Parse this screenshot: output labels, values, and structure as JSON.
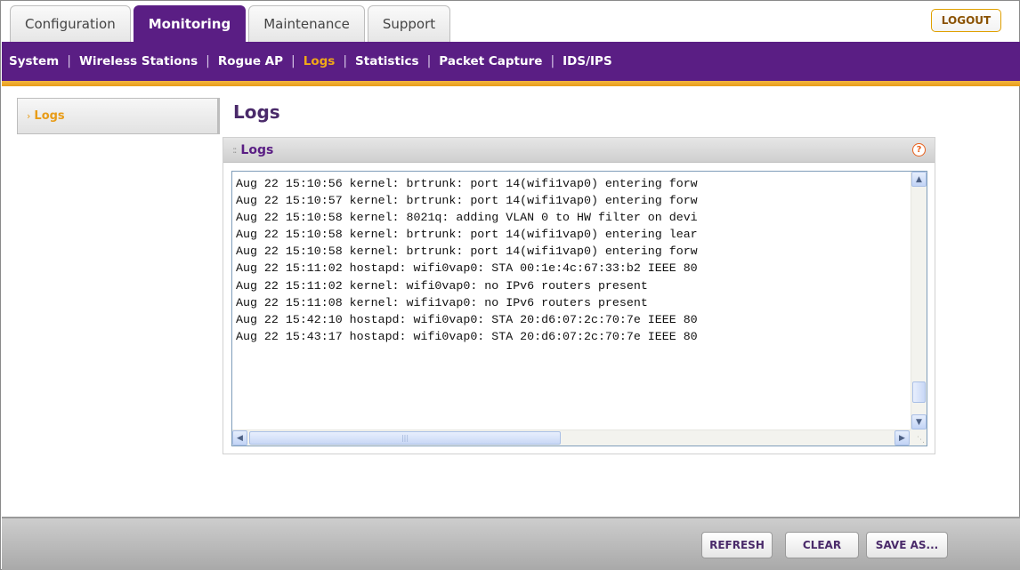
{
  "tabs": [
    {
      "label": "Configuration",
      "active": false
    },
    {
      "label": "Monitoring",
      "active": true
    },
    {
      "label": "Maintenance",
      "active": false
    },
    {
      "label": "Support",
      "active": false
    }
  ],
  "logout_label": "LOGOUT",
  "subnav": [
    {
      "label": "System"
    },
    {
      "label": "Wireless Stations"
    },
    {
      "label": "Rogue AP"
    },
    {
      "label": "Logs",
      "active": true
    },
    {
      "label": "Statistics"
    },
    {
      "label": "Packet Capture"
    },
    {
      "label": "IDS/IPS"
    }
  ],
  "sidebar": {
    "items": [
      {
        "label": "Logs",
        "active": true
      }
    ]
  },
  "page_title": "Logs",
  "panel": {
    "title": "Logs",
    "help_icon": "help-icon",
    "log_lines": [
      "Aug 22 15:10:56 kernel: brtrunk: port 14(wifi1vap0) entering forw",
      "Aug 22 15:10:57 kernel: brtrunk: port 14(wifi1vap0) entering forw",
      "Aug 22 15:10:58 kernel: 8021q: adding VLAN 0 to HW filter on devi",
      "Aug 22 15:10:58 kernel: brtrunk: port 14(wifi1vap0) entering lear",
      "Aug 22 15:10:58 kernel: brtrunk: port 14(wifi1vap0) entering forw",
      "Aug 22 15:11:02 hostapd: wifi0vap0: STA 00:1e:4c:67:33:b2 IEEE 80",
      "Aug 22 15:11:02 kernel: wifi0vap0: no IPv6 routers present",
      "Aug 22 15:11:08 kernel: wifi1vap0: no IPv6 routers present",
      "Aug 22 15:42:10 hostapd: wifi0vap0: STA 20:d6:07:2c:70:7e IEEE 80",
      "Aug 22 15:43:17 hostapd: wifi0vap0: STA 20:d6:07:2c:70:7e IEEE 80"
    ]
  },
  "footer": {
    "refresh_label": "REFRESH",
    "clear_label": "CLEAR",
    "save_as_label": "SAVE AS..."
  },
  "colors": {
    "primary_purple": "#5a1e84",
    "accent_orange": "#e89c18"
  }
}
